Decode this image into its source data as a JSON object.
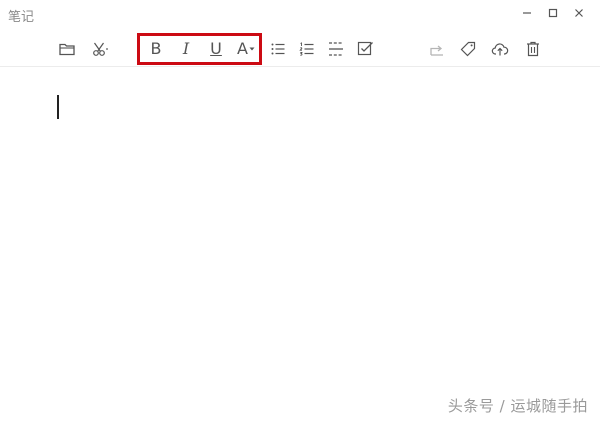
{
  "window": {
    "title": "笔记",
    "controls": [
      "minimize-icon",
      "maximize-icon",
      "close-icon"
    ]
  },
  "toolbar": {
    "groups": [
      {
        "name": "file",
        "items": [
          "folder-icon",
          "scissors-icon"
        ]
      },
      {
        "name": "text-format",
        "highlighted": true,
        "highlight_color": "#cc0a13",
        "items": [
          {
            "icon": "bold-icon",
            "label": "B"
          },
          {
            "icon": "italic-icon",
            "label": "I"
          },
          {
            "icon": "underline-icon",
            "label": "U"
          },
          {
            "icon": "font-color-icon",
            "label": "A"
          }
        ]
      },
      {
        "name": "paragraph",
        "items": [
          "bullet-list-icon",
          "numbered-list-icon",
          "divider-icon",
          "checkbox-icon"
        ]
      },
      {
        "name": "note-actions",
        "items": [
          "share-icon",
          "tag-icon",
          "cloud-upload-icon",
          "trash-icon"
        ]
      }
    ]
  },
  "editor": {
    "content": ""
  },
  "watermark": "头条号 / 运城随手拍"
}
